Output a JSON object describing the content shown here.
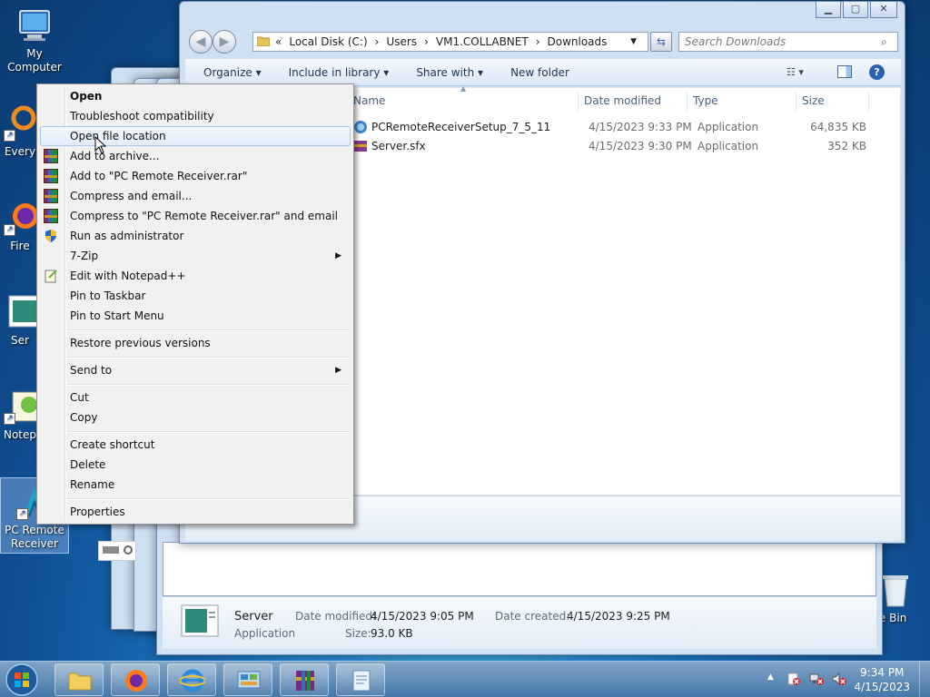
{
  "desktop": {
    "icons": [
      {
        "label": "My Computer"
      },
      {
        "label": "Every"
      },
      {
        "label": "Fire"
      },
      {
        "label": "Ser"
      },
      {
        "label": "Notep"
      },
      {
        "label": "PC Remote Receiver"
      },
      {
        "label": "cle Bin"
      }
    ]
  },
  "explorer": {
    "address": {
      "crumbs": [
        "«",
        "Local Disk (C:)",
        "›",
        "Users",
        "›",
        "VM1.COLLABNET",
        "›",
        "Downloads"
      ]
    },
    "search_placeholder": "Search Downloads",
    "toolbar": {
      "organize": "Organize ▾",
      "include": "Include in library ▾",
      "share": "Share with ▾",
      "newfolder": "New folder"
    },
    "columns": {
      "name": "Name",
      "date": "Date modified",
      "type": "Type",
      "size": "Size"
    },
    "files": [
      {
        "name": "PCRemoteReceiverSetup_7_5_11",
        "date": "4/15/2023 9:33 PM",
        "type": "Application",
        "size": "64,835 KB"
      },
      {
        "name": "Server.sfx",
        "date": "4/15/2023 9:30 PM",
        "type": "Application",
        "size": "352 KB"
      }
    ]
  },
  "details_pane": {
    "name": "Server",
    "kind": "Application",
    "date_modified_label": "Date modified:",
    "date_modified": "4/15/2023 9:05 PM",
    "date_created_label": "Date created:",
    "date_created": "4/15/2023 9:25 PM",
    "size_label": "Size:",
    "size": "93.0 KB"
  },
  "context_menu": {
    "items": [
      {
        "label": "Open"
      },
      {
        "label": "Troubleshoot compatibility"
      },
      {
        "label": "Open file location"
      },
      {
        "label": "Add to archive..."
      },
      {
        "label": "Add to \"PC Remote Receiver.rar\""
      },
      {
        "label": "Compress and email..."
      },
      {
        "label": "Compress to \"PC Remote Receiver.rar\" and email"
      },
      {
        "label": "Run as administrator"
      },
      {
        "label": "7-Zip"
      },
      {
        "label": "Edit with Notepad++"
      },
      {
        "label": "Pin to Taskbar"
      },
      {
        "label": "Pin to Start Menu"
      },
      {
        "label": "Restore previous versions"
      },
      {
        "label": "Send to"
      },
      {
        "label": "Cut"
      },
      {
        "label": "Copy"
      },
      {
        "label": "Create shortcut"
      },
      {
        "label": "Delete"
      },
      {
        "label": "Rename"
      },
      {
        "label": "Properties"
      }
    ]
  },
  "taskbar": {
    "clock_time": "9:34 PM",
    "clock_date": "4/15/2023",
    "tray_arrow": "▲"
  }
}
